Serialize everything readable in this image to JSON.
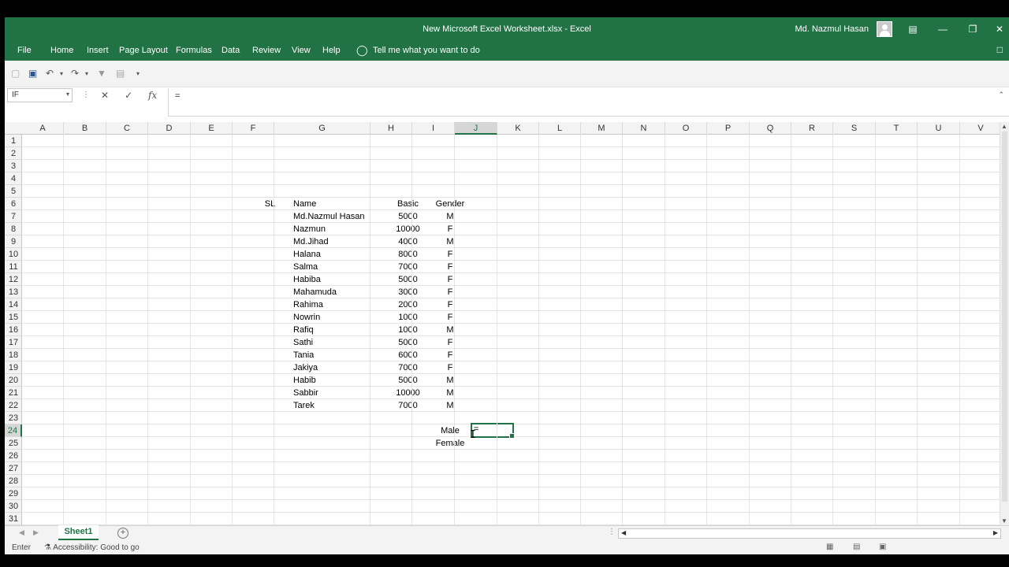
{
  "window": {
    "title": "New Microsoft Excel Worksheet.xlsx  -  Excel",
    "user": "Md. Nazmul Hasan"
  },
  "ribbon": {
    "tabs": [
      "File",
      "Home",
      "Insert",
      "Page Layout",
      "Formulas",
      "Data",
      "Review",
      "View",
      "Help"
    ],
    "tell_me": "Tell me what you want to do"
  },
  "formula_bar": {
    "name_box": "IF",
    "formula": "="
  },
  "columns": [
    "A",
    "B",
    "C",
    "D",
    "E",
    "F",
    "G",
    "H",
    "I",
    "J",
    "K",
    "L",
    "M",
    "N",
    "O",
    "P",
    "Q",
    "R",
    "S",
    "T",
    "U",
    "V"
  ],
  "selected_column": "J",
  "rows": [
    "1",
    "2",
    "3",
    "4",
    "5",
    "6",
    "7",
    "8",
    "9",
    "10",
    "11",
    "12",
    "13",
    "14",
    "15",
    "16",
    "17",
    "18",
    "19",
    "20",
    "21",
    "22",
    "23",
    "24",
    "25",
    "26",
    "27",
    "28",
    "29",
    "30",
    "31"
  ],
  "selected_row": "24",
  "table": {
    "headers": {
      "sl": "SL",
      "name": "Name",
      "basic": "Basic",
      "gender": "Gender"
    },
    "records": [
      {
        "name": "Md.Nazmul Hasan",
        "basic": "5000",
        "gender": "M"
      },
      {
        "name": "Nazmun",
        "basic": "10000",
        "gender": "F"
      },
      {
        "name": "Md.Jihad",
        "basic": "4000",
        "gender": "M"
      },
      {
        "name": "Halana",
        "basic": "8000",
        "gender": "F"
      },
      {
        "name": "Salma",
        "basic": "7000",
        "gender": "F"
      },
      {
        "name": "Habiba",
        "basic": "5000",
        "gender": "F"
      },
      {
        "name": "Mahamuda",
        "basic": "3000",
        "gender": "F"
      },
      {
        "name": "Rahima",
        "basic": "2000",
        "gender": "F"
      },
      {
        "name": "Nowrin",
        "basic": "1000",
        "gender": "F"
      },
      {
        "name": "Rafiq",
        "basic": "1000",
        "gender": "M"
      },
      {
        "name": "Sathi",
        "basic": "5000",
        "gender": "F"
      },
      {
        "name": "Tania",
        "basic": "6000",
        "gender": "F"
      },
      {
        "name": "Jakiya",
        "basic": "7000",
        "gender": "F"
      },
      {
        "name": "Habib",
        "basic": "5000",
        "gender": "M"
      },
      {
        "name": "Sabbir",
        "basic": "10000",
        "gender": "M"
      },
      {
        "name": "Tarek",
        "basic": "7000",
        "gender": "M"
      }
    ]
  },
  "summary": {
    "male": "Male",
    "female": "Female"
  },
  "active_cell_value": "=",
  "sheet_tab": "Sheet1",
  "status": {
    "mode": "Enter",
    "accessibility": "Accessibility: Good to go"
  }
}
